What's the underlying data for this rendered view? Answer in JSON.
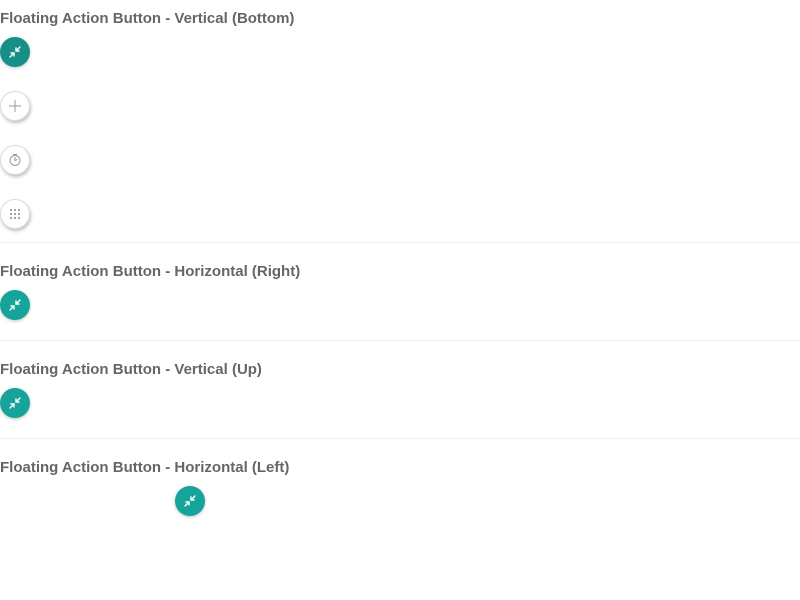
{
  "sections": [
    {
      "title": "Floating Action Button - Vertical (Bottom)",
      "main_button": {
        "icon": "compress-arrows-icon"
      },
      "actions": [
        {
          "icon": "plus-icon"
        },
        {
          "icon": "clock-icon"
        },
        {
          "icon": "grid-dots-icon"
        }
      ]
    },
    {
      "title": "Floating Action Button - Horizontal (Right)",
      "main_button": {
        "icon": "compress-arrows-icon"
      }
    },
    {
      "title": "Floating Action Button - Vertical (Up)",
      "main_button": {
        "icon": "compress-arrows-icon"
      }
    },
    {
      "title": "Floating Action Button - Horizontal (Left)",
      "main_button": {
        "icon": "compress-arrows-icon"
      }
    }
  ],
  "colors": {
    "accent": "#16a39a",
    "accent_dark": "#168f87",
    "title_text": "#666666",
    "secondary_icon": "#9a9a9a",
    "divider": "#eeeeee"
  }
}
